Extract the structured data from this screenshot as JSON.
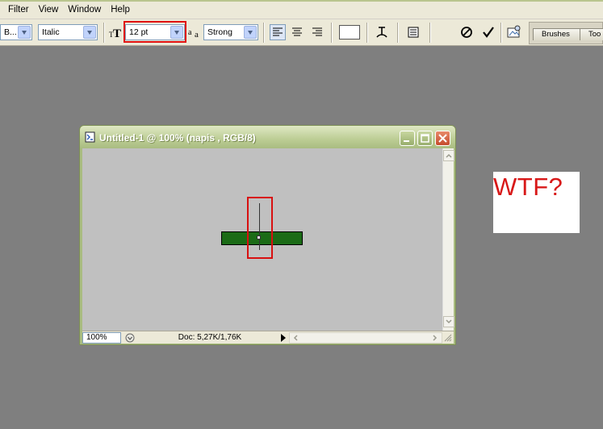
{
  "menu": {
    "items": [
      "Filter",
      "View",
      "Window",
      "Help"
    ]
  },
  "options_bar": {
    "font_family": "B...",
    "font_style": "Italic",
    "font_size": "12 pt",
    "antialias": "Strong",
    "text_color": "#ffffff",
    "icons": [
      "text-orientation-icon",
      "font-size-icon",
      "antialias-icon",
      "align-left-icon",
      "align-center-icon",
      "align-right-icon",
      "warp-text-icon",
      "character-palette-icon",
      "cancel-icon",
      "commit-icon",
      "file-browser-icon"
    ]
  },
  "palette_well": {
    "tabs": [
      "Brushes",
      "Too"
    ]
  },
  "document": {
    "title": "Untitled-1 @ 100% (napis , RGB/8)",
    "zoom": "100%",
    "doc_info": "Doc: 5,27K/1,76K",
    "layer_color": "#1b6b16"
  },
  "annotation": {
    "text": "WTF?",
    "color": "#d81818"
  }
}
